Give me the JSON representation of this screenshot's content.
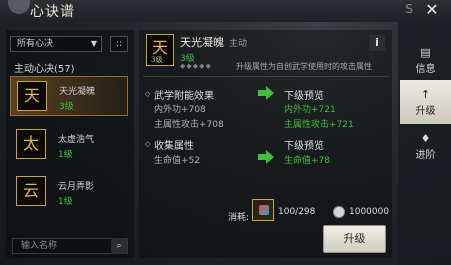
{
  "window": {
    "title": "心诀谱",
    "close_label": "✕",
    "brand_text": "S"
  },
  "filter": {
    "selected": "所有心决",
    "arrow": "▼",
    "grid_icon": "::"
  },
  "list": {
    "header": "主动心决(57)",
    "items": [
      {
        "glyph": "天",
        "name": "天光凝魄",
        "level": "3级",
        "selected": true
      },
      {
        "glyph": "太",
        "name": "太虚浩气",
        "level": "1级",
        "selected": false
      },
      {
        "glyph": "云",
        "name": "云月弄影",
        "level": "1级",
        "selected": false
      }
    ]
  },
  "search": {
    "placeholder": "输入名称",
    "icon": "⌕"
  },
  "skill": {
    "glyph": "天",
    "chip_level": "3级",
    "name": "天光凝魄",
    "type": "主动",
    "level": "3级",
    "stars": "◆◆◆◆◆",
    "description": "升级属性为自创武学使用时的攻击属性",
    "info_label": "i"
  },
  "stats": {
    "current_title": "武学附能效果",
    "current_lines": [
      "内外功+708",
      "主属性攻击+708"
    ],
    "preview_title": "下级预览",
    "preview_lines": [
      "内外功+721",
      "主属性攻击+721"
    ],
    "collect_title": "收集属性",
    "collect_current": "生命值+52",
    "collect_preview_title": "下级预览",
    "collect_preview": "生命值+78"
  },
  "cost": {
    "label": "消耗:",
    "item_count": "100/298",
    "coin_amount": "1000000"
  },
  "upgrade_button": "升级",
  "tabs": [
    {
      "icon": "▤",
      "label": "信息",
      "active": false
    },
    {
      "icon": "↑",
      "label": "升级",
      "active": true
    },
    {
      "icon": "♦",
      "label": "进阶",
      "active": false
    }
  ],
  "colors": {
    "accent_green": "#3fbf3a",
    "gold": "#c9a44e",
    "panel": "#1b1e22"
  }
}
